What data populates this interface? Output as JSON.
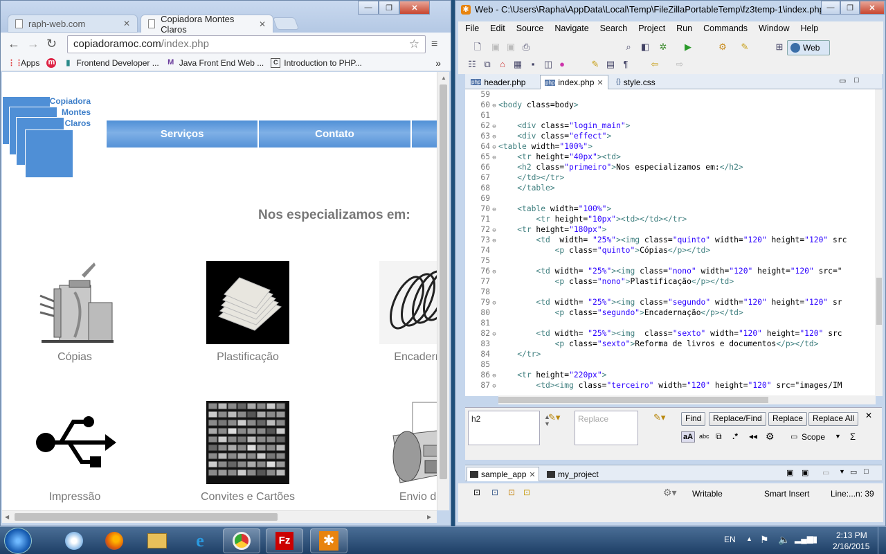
{
  "chrome": {
    "tabs": [
      {
        "label": "raph-web.com",
        "active": false
      },
      {
        "label": "Copiadora Montes Claros",
        "active": true
      }
    ],
    "url_host": "copiadoramoc.com",
    "url_path": "/index.php",
    "bookmarks": [
      {
        "label": "Apps",
        "icon": "apps-grid-icon"
      },
      {
        "label": "",
        "icon": "m-logo-icon"
      },
      {
        "label": "Frontend Developer ...",
        "icon": "bookmark-icon"
      },
      {
        "label": "Java Front End Web ...",
        "icon": "m-logo-icon"
      },
      {
        "label": "Introduction to PHP...",
        "icon": "c-logo-icon"
      }
    ],
    "overflow": "»"
  },
  "site": {
    "logo_lines": [
      "Copiadora",
      "Montes",
      "Claros"
    ],
    "nav": [
      "Serviços",
      "Contato"
    ],
    "heading": "Nos especializamos em:",
    "services": [
      {
        "label": "Cópias",
        "icon": "copier-icon"
      },
      {
        "label": "Plastificação",
        "icon": "laminated-cards-icon"
      },
      {
        "label": "Encaderna",
        "icon": "spiral-binding-icon"
      },
      {
        "label": "Impressão",
        "icon": "usb-icon"
      },
      {
        "label": "Convites e Cartões",
        "icon": "cards-collage-icon"
      },
      {
        "label": "Envio de",
        "icon": "fax-machine-icon"
      }
    ]
  },
  "eclipse": {
    "title": "Web - C:\\Users\\Rapha\\AppData\\Local\\Temp\\FileZillaPortableTemp\\fz3temp-1\\index.php...",
    "menu": [
      "File",
      "Edit",
      "Source",
      "Navigate",
      "Search",
      "Project",
      "Run",
      "Commands",
      "Window",
      "Help"
    ],
    "perspective": "Web",
    "editor_tabs": [
      {
        "label": "header.php",
        "active": false
      },
      {
        "label": "index.php",
        "active": true
      },
      {
        "label": "style.css",
        "active": false
      }
    ],
    "code_lines": [
      {
        "n": "59",
        "fold": "",
        "text": ""
      },
      {
        "n": "60",
        "fold": "⊖",
        "text": "<body class=body>"
      },
      {
        "n": "61",
        "fold": "",
        "text": ""
      },
      {
        "n": "62",
        "fold": "⊖",
        "text": "    <div class=\"login_main\">"
      },
      {
        "n": "63",
        "fold": "⊖",
        "text": "    <div class=\"effect\">"
      },
      {
        "n": "64",
        "fold": "⊖",
        "text": "<table width=\"100%\">"
      },
      {
        "n": "65",
        "fold": "⊖",
        "text": "    <tr height=\"40px\"><td>"
      },
      {
        "n": "66",
        "fold": "",
        "text": "    <h2 class=\"primeiro\">Nos especializamos em:</h2>"
      },
      {
        "n": "67",
        "fold": "",
        "text": "    </td></tr>"
      },
      {
        "n": "68",
        "fold": "",
        "text": "    </table>"
      },
      {
        "n": "69",
        "fold": "",
        "text": ""
      },
      {
        "n": "70",
        "fold": "⊖",
        "text": "    <table width=\"100%\">"
      },
      {
        "n": "71",
        "fold": "",
        "text": "        <tr height=\"10px\"><td></td></tr>"
      },
      {
        "n": "72",
        "fold": "⊖",
        "text": "    <tr height=\"180px\">"
      },
      {
        "n": "73",
        "fold": "⊖",
        "text": "        <td  width= \"25%\"><img class=\"quinto\" width=\"120\" height=\"120\" src"
      },
      {
        "n": "74",
        "fold": "",
        "text": "            <p class=\"quinto\">Cópias</p></td>"
      },
      {
        "n": "75",
        "fold": "",
        "text": ""
      },
      {
        "n": "76",
        "fold": "⊖",
        "text": "        <td width= \"25%\"><img class=\"nono\" width=\"120\" height=\"120\" src=\""
      },
      {
        "n": "77",
        "fold": "",
        "text": "            <p class=\"nono\">Plastificação</p></td>"
      },
      {
        "n": "78",
        "fold": "",
        "text": ""
      },
      {
        "n": "79",
        "fold": "⊖",
        "text": "        <td width= \"25%\"><img class=\"segundo\" width=\"120\" height=\"120\" sr"
      },
      {
        "n": "80",
        "fold": "",
        "text": "            <p class=\"segundo\">Encadernação</p></td>"
      },
      {
        "n": "81",
        "fold": "",
        "text": ""
      },
      {
        "n": "82",
        "fold": "⊖",
        "text": "        <td width= \"25%\"><img  class=\"sexto\" width=\"120\" height=\"120\" src"
      },
      {
        "n": "83",
        "fold": "",
        "text": "            <p class=\"sexto\">Reforma de livros e documentos</p></td>"
      },
      {
        "n": "84",
        "fold": "",
        "text": "    </tr>"
      },
      {
        "n": "85",
        "fold": "",
        "text": ""
      },
      {
        "n": "86",
        "fold": "⊖",
        "text": "    <tr height=\"220px\">"
      },
      {
        "n": "87",
        "fold": "⊖",
        "text": "        <td><img class=\"terceiro\" width=\"120\" height=\"120\" src=\"images/IM"
      }
    ],
    "find": {
      "find_value": "h2",
      "replace_placeholder": "Replace",
      "buttons": [
        "Find",
        "Replace/Find",
        "Replace",
        "Replace All"
      ],
      "scope_label": "Scope"
    },
    "views": [
      {
        "label": "sample_app",
        "active": true
      },
      {
        "label": "my_project",
        "active": false
      }
    ],
    "status": {
      "writable": "Writable",
      "insert_mode": "Smart Insert",
      "position": "Line:...n: 39"
    }
  },
  "taskbar": {
    "apps": [
      "internet-explorer-icon",
      "firefox-icon",
      "explorer-folder-icon",
      "ie-icon",
      "chrome-icon",
      "filezilla-icon",
      "eclipse-gear-icon"
    ],
    "language": "EN",
    "time": "2:13 PM",
    "date": "2/16/2015"
  }
}
